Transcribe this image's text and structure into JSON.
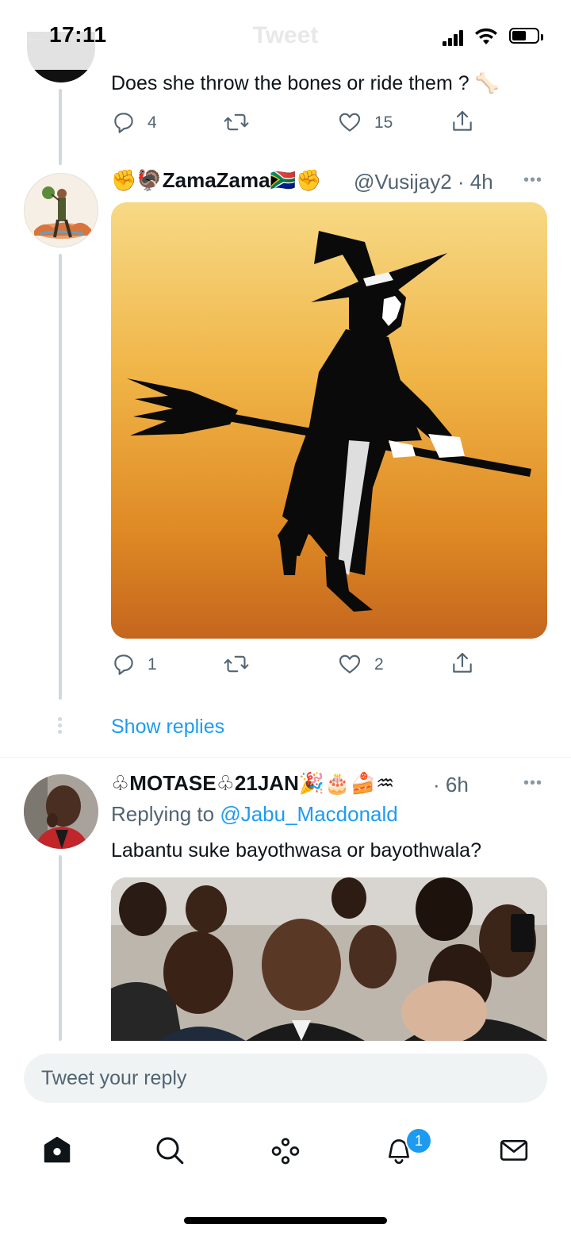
{
  "status": {
    "time": "17:11",
    "header_title": "Tweet"
  },
  "tweet1": {
    "text": "Does she throw the bones or ride them ? 🦴",
    "reply_count": "4",
    "like_count": "15"
  },
  "tweet2": {
    "display_name": "✊🦃ZamaZama🇿🇦✊",
    "handle_time": "@Vusijay2 · 4h",
    "image_alt": "Witch flying on broomstick silhouette",
    "reply_count": "1",
    "like_count": "2",
    "show_replies": "Show replies"
  },
  "tweet3": {
    "display_name": "♧MOTASE♧21JAN🎉🎂🍰♒",
    "time": "· 6h",
    "replying_prefix": "Replying to",
    "replying_to": "@Jabu_Macdonald",
    "text": "Labantu suke bayothwasa or bayothwala?",
    "image_alt": "Crowd of people at an event"
  },
  "reply": {
    "placeholder": "Tweet your reply"
  },
  "tabbar": {
    "items": [
      "home-icon",
      "search-icon",
      "spaces-icon",
      "notifications-icon",
      "messages-icon"
    ],
    "notification_badge": "1"
  },
  "colors": {
    "accent": "#1d9bf0",
    "text": "#0f1419",
    "secondary": "#536471"
  }
}
